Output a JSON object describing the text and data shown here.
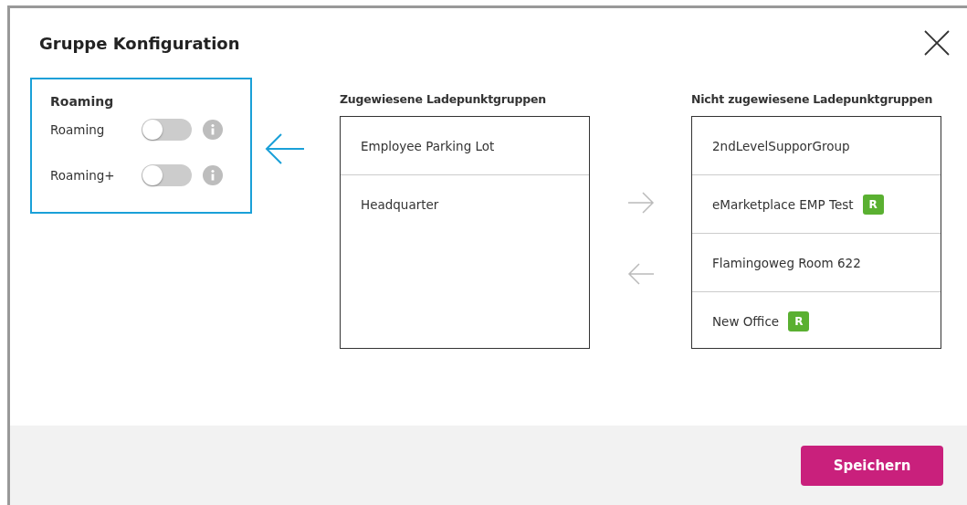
{
  "dialog": {
    "title": "Gruppe Konfiguration"
  },
  "roaming": {
    "heading": "Roaming",
    "toggles": [
      {
        "label": "Roaming",
        "on": false
      },
      {
        "label": "Roaming+",
        "on": false
      }
    ]
  },
  "assigned": {
    "heading": "Zugewiesene Ladepunktgruppen",
    "items": [
      {
        "name": "Employee Parking Lot"
      },
      {
        "name": "Headquarter"
      }
    ]
  },
  "unassigned": {
    "heading": "Nicht zugewiesene Ladepunktgruppen",
    "items": [
      {
        "name": "2ndLevelSupporGroup"
      },
      {
        "name": "eMarketplace EMP Test",
        "badge": "R"
      },
      {
        "name": "Flamingoweg Room 622"
      },
      {
        "name": "New Office",
        "badge": "R"
      }
    ]
  },
  "footer": {
    "save_button": "Speichern"
  }
}
